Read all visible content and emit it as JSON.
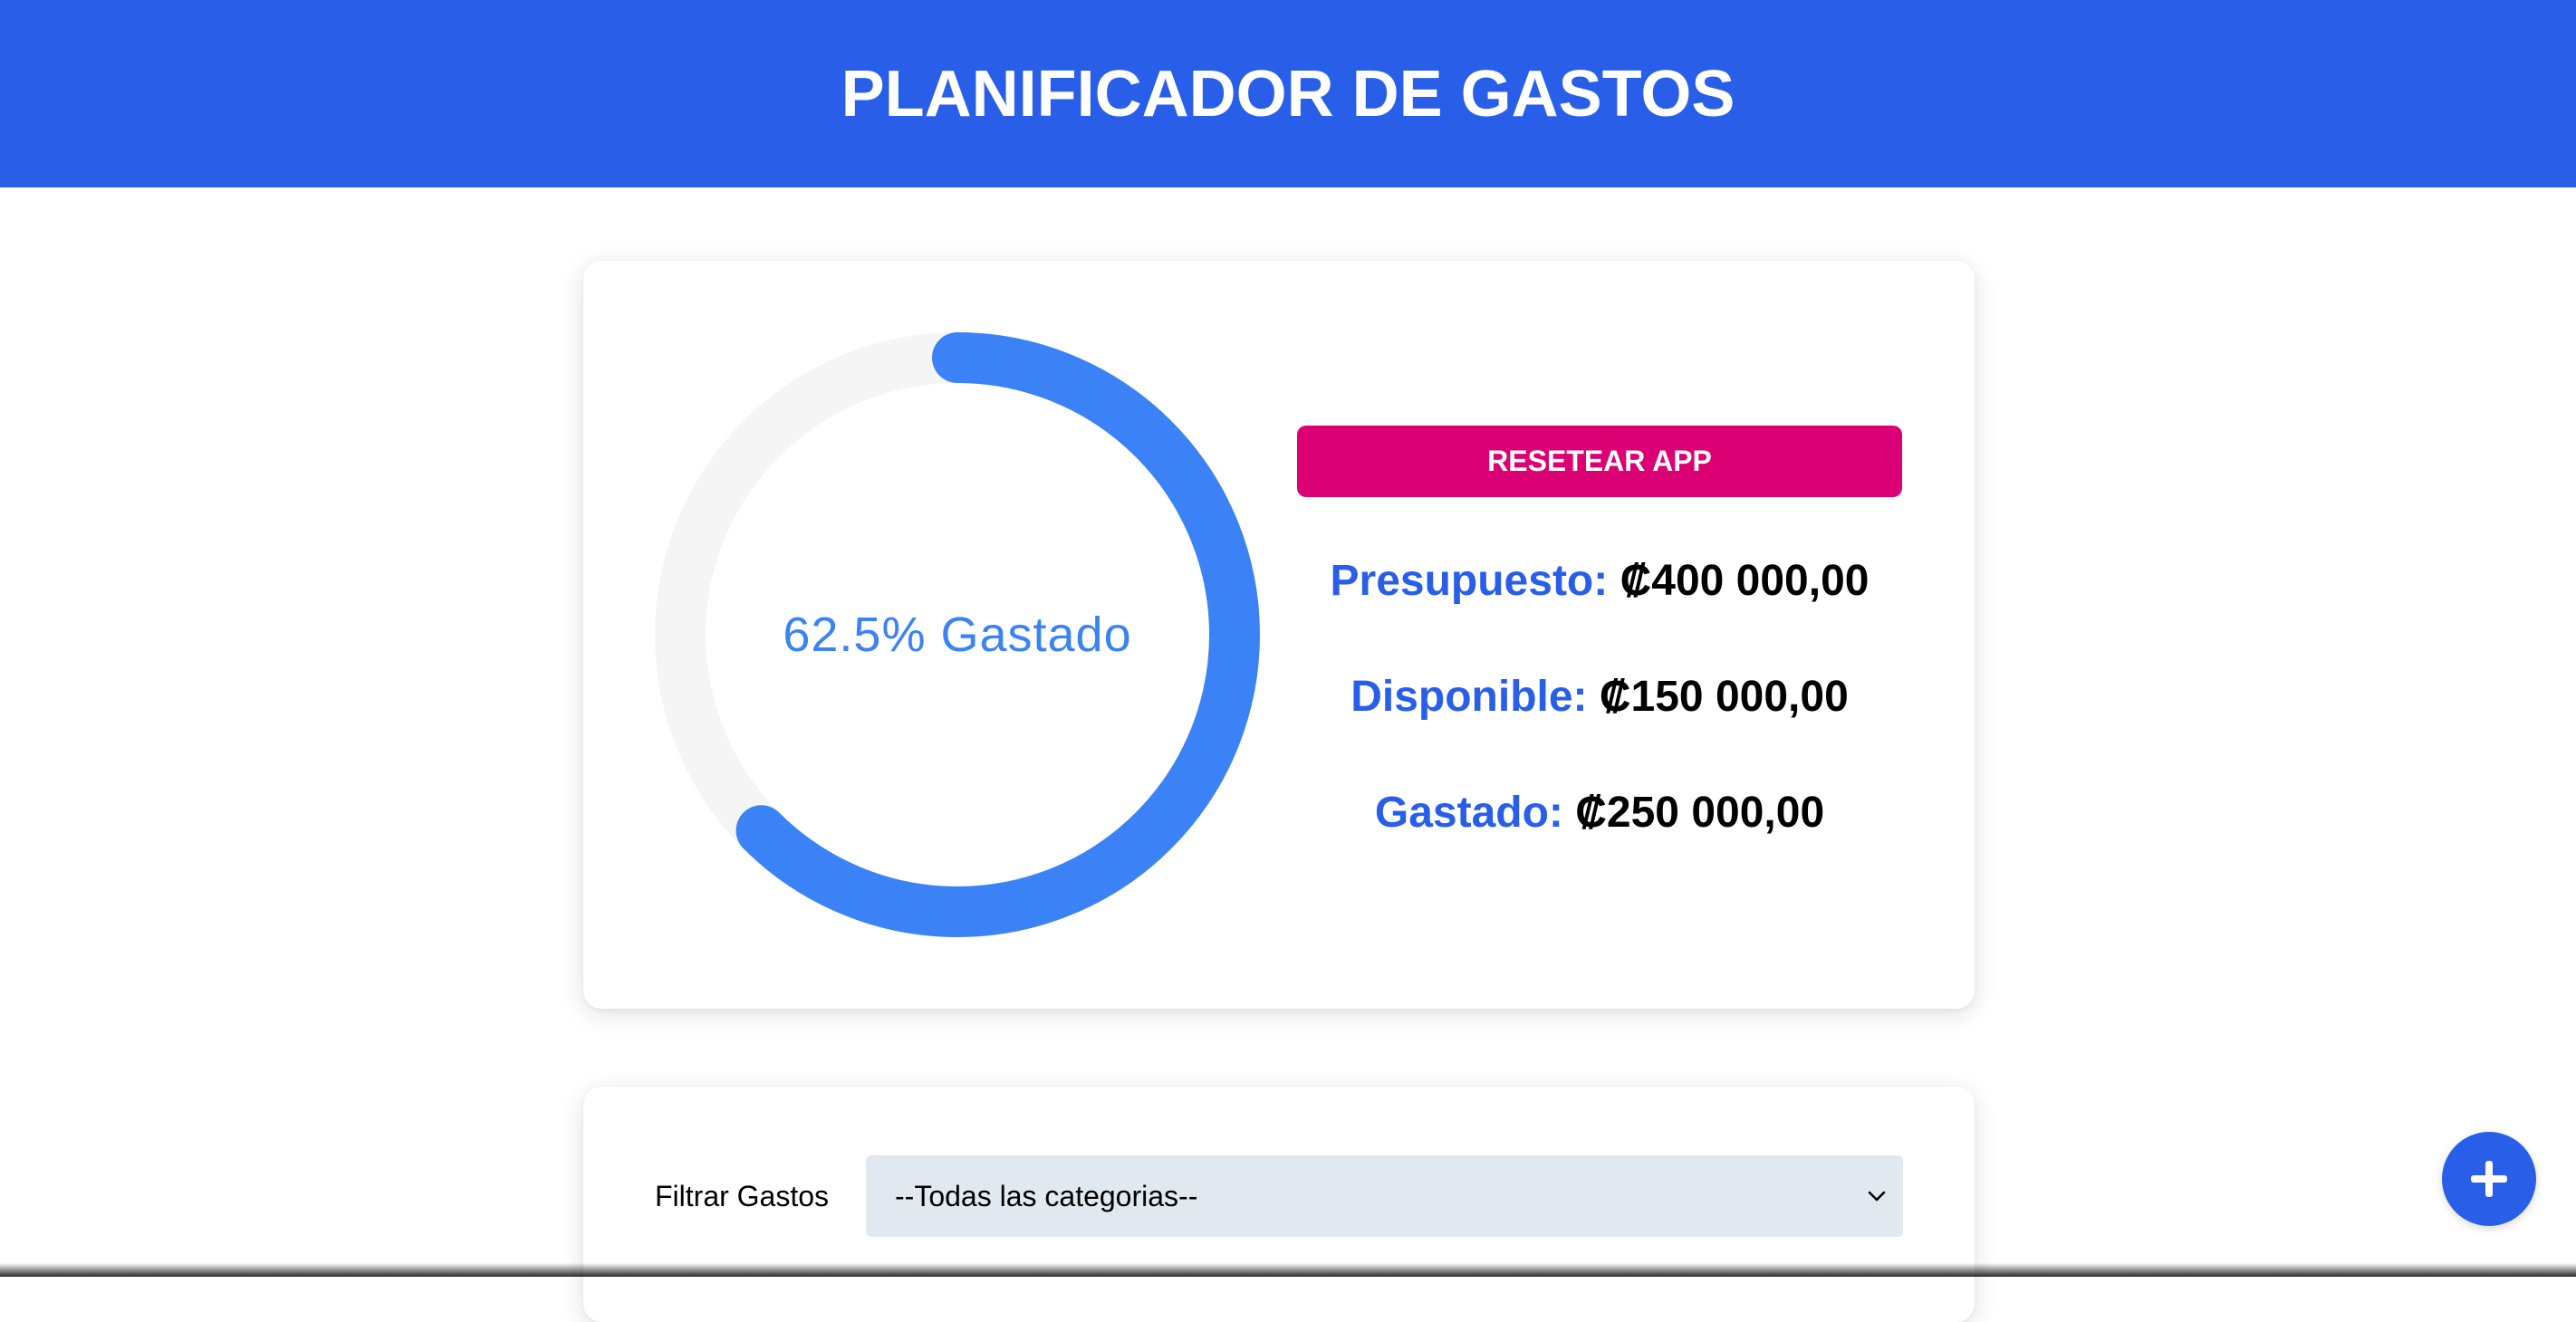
{
  "header": {
    "title": "PLANIFICADOR DE GASTOS"
  },
  "budget": {
    "percent_spent": 62.5,
    "progress_label": "62.5% Gastado",
    "reset_label": "RESETEAR APP",
    "stats": [
      {
        "label": "Presupuesto:",
        "value": "₡400 000,00"
      },
      {
        "label": "Disponible:",
        "value": "₡150 000,00"
      },
      {
        "label": "Gastado:",
        "value": "₡250 000,00"
      }
    ]
  },
  "filter": {
    "label": "Filtrar Gastos",
    "selected": "--Todas las categorias--"
  },
  "colors": {
    "primary": "#295ee9",
    "progress": "#3b82f6",
    "track": "#f5f5f5",
    "reset": "#db0073"
  },
  "icons": {
    "add": "plus-icon",
    "select": "chevron-down-icon"
  }
}
